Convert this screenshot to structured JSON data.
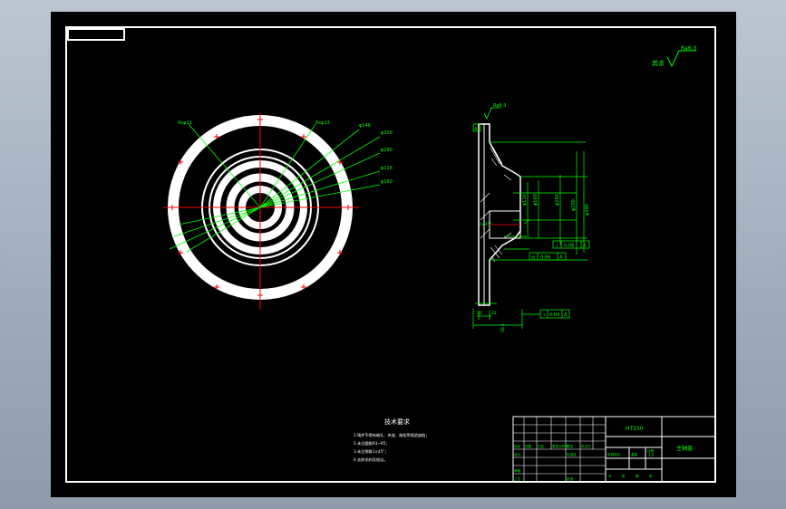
{
  "drawing": {
    "surface_symbol": {
      "prefix": "其余",
      "value": "Ra6.3"
    },
    "front_view": {
      "callouts": [
        "4xφ11",
        "8xφ13",
        "φ146",
        "φ200",
        "φ290",
        "φ116",
        "φ160"
      ]
    },
    "section_view": {
      "surface_label": "Ra6.3",
      "dims": [
        "φ390",
        "φ200",
        "φ260",
        "φ160",
        "φ116"
      ],
      "frames": [
        [
          "⊥",
          "0.08",
          "A"
        ],
        [
          "◎",
          "0.06",
          "A"
        ],
        [
          "⊥",
          "0.04",
          "A"
        ]
      ],
      "datum": "A",
      "bottom_dims": [
        "2×45°",
        "20",
        "22",
        "56.1"
      ]
    },
    "notes": {
      "title": "技术要求",
      "lines": [
        "1.铸件不得有缩孔、夹渣、疏松等铸造缺陷；",
        "2.未注圆角R3~R5；",
        "3.未注倒角1×45°；",
        "4.去除毛刺及锐边。"
      ]
    },
    "title_block": {
      "material": "HT150",
      "part_name": "主轴盖",
      "scale": "1:5",
      "labels": [
        "标记",
        "处数",
        "分区",
        "更改文件号",
        "签名",
        "年月日",
        "设计",
        "标准化",
        "审核",
        "工艺",
        "批准",
        "阶段标记",
        "重量",
        "比例",
        "共",
        "张",
        "第",
        "张"
      ]
    }
  },
  "colors": {
    "sheet": "#000000",
    "outline": "#ffffff",
    "dimension": "#00ff00",
    "center": "#ff0000"
  }
}
